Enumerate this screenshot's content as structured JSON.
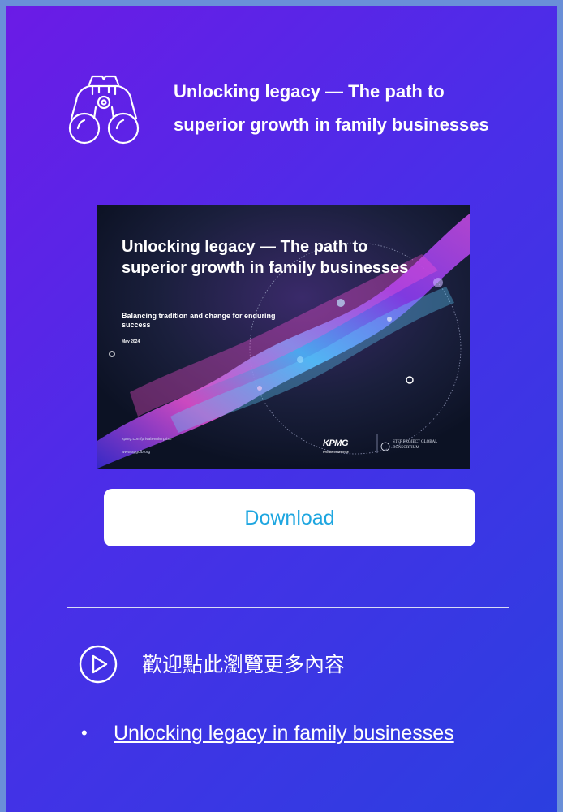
{
  "header": {
    "icon": "binoculars-icon",
    "title": "Unlocking legacy — The path to superior growth in family businesses"
  },
  "cover": {
    "title": "Unlocking legacy — The path to superior growth in family businesses",
    "subtitle": "Balancing tradition and change for enduring success",
    "date": "May 2024",
    "url1": "kpmg.com/privateenterprise",
    "url2": "www.spgcfb.org",
    "brand": "KPMG",
    "brand_sub": "Private Enterprise",
    "partner": "STEP PROJECT GLOBAL CONSORTIUM"
  },
  "download": {
    "label": "Download"
  },
  "more": {
    "icon": "play-circle-icon",
    "text": "歡迎點此瀏覽更多內容"
  },
  "links": [
    {
      "bullet": "•",
      "label": "Unlocking legacy in family businesses"
    }
  ],
  "colors": {
    "gradient_start": "#6b1be6",
    "gradient_end": "#2b3fe0",
    "button_text": "#1ea6e0"
  }
}
